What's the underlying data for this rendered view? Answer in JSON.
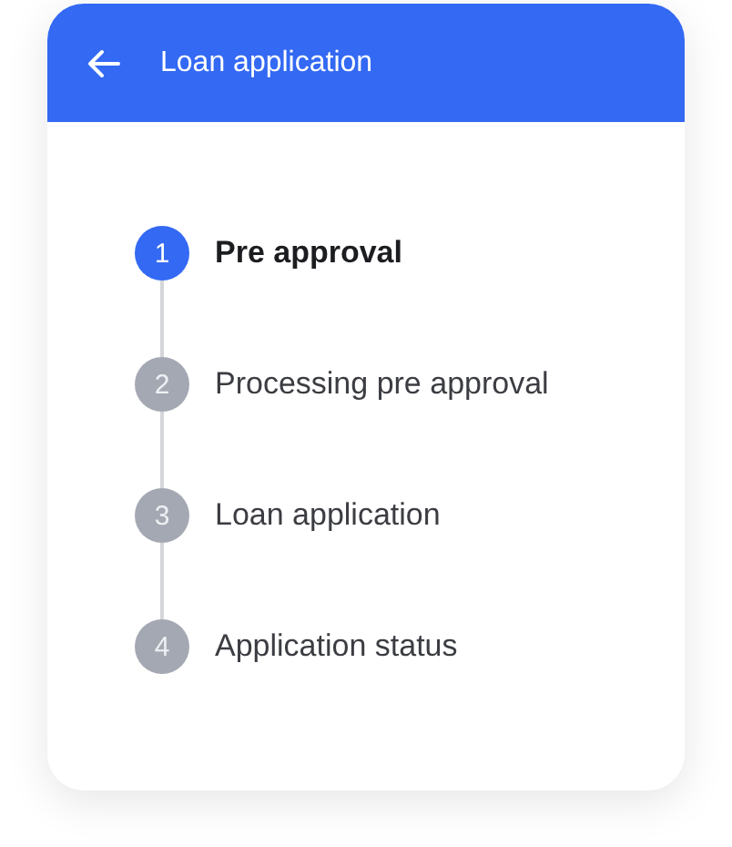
{
  "header": {
    "title": "Loan application"
  },
  "steps": [
    {
      "number": "1",
      "label": "Pre approval",
      "current": true
    },
    {
      "number": "2",
      "label": "Processing pre approval",
      "current": false
    },
    {
      "number": "3",
      "label": "Loan application",
      "current": false
    },
    {
      "number": "4",
      "label": "Application status",
      "current": false
    }
  ]
}
